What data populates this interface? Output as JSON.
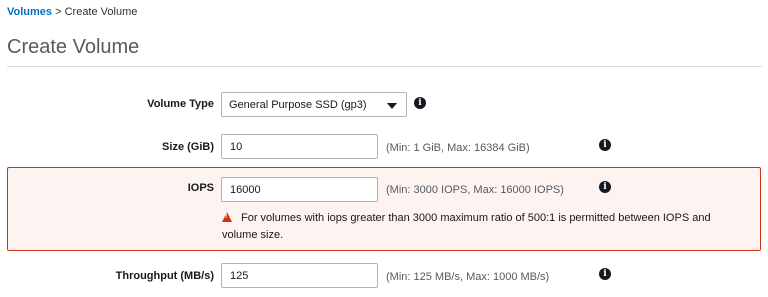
{
  "breadcrumb": {
    "parent": "Volumes",
    "separator": ">",
    "current": "Create Volume"
  },
  "page": {
    "title": "Create Volume"
  },
  "form": {
    "volume_type": {
      "label": "Volume Type",
      "selected": "General Purpose SSD (gp3)"
    },
    "size": {
      "label": "Size (GiB)",
      "value": "10",
      "hint": "(Min: 1 GiB, Max: 16384 GiB)"
    },
    "iops": {
      "label": "IOPS",
      "value": "16000",
      "hint": "(Min: 3000 IOPS, Max: 16000 IOPS)",
      "error": "For volumes with iops greater than 3000 maximum ratio of 500:1 is permitted between IOPS and volume size."
    },
    "throughput": {
      "label": "Throughput (MB/s)",
      "value": "125",
      "hint": "(Min: 125 MB/s, Max: 1000 MB/s)"
    }
  },
  "icons": {
    "info": "i",
    "warning": "warning-triangle-icon"
  },
  "colors": {
    "link": "#0073bb",
    "error_border": "#d13212",
    "error_bg": "#fdf3f1",
    "title": "#545b64"
  }
}
